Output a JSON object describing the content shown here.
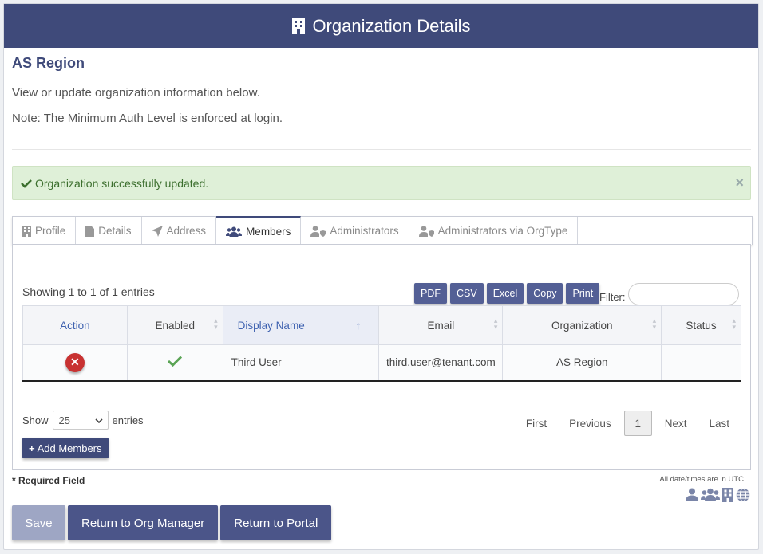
{
  "header": {
    "title": "Organization Details",
    "icon": "building-icon"
  },
  "org": {
    "name": "AS Region",
    "intro": "View or update organization information below.",
    "note": "Note: The Minimum Auth Level is enforced at login."
  },
  "alert": {
    "message": "Organization successfully updated.",
    "close": "×"
  },
  "tabs": [
    {
      "label": "Profile",
      "icon": "building-icon"
    },
    {
      "label": "Details",
      "icon": "document-icon"
    },
    {
      "label": "Address",
      "icon": "location-arrow-icon"
    },
    {
      "label": "Members",
      "icon": "users-icon"
    },
    {
      "label": "Administrators",
      "icon": "user-shield-icon"
    },
    {
      "label": "Administrators via OrgType",
      "icon": "user-shield-icon"
    }
  ],
  "table": {
    "showing": "Showing 1 to 1 of 1 entries",
    "exports": [
      "PDF",
      "CSV",
      "Excel",
      "Copy",
      "Print"
    ],
    "filter_label": "Filter:",
    "columns": [
      "Action",
      "Enabled",
      "Display Name",
      "Email",
      "Organization",
      "Status"
    ],
    "sort_arrow": "↑",
    "rows": [
      {
        "enabled": true,
        "display_name": "Third User",
        "email": "third.user@tenant.com",
        "organization": "AS Region",
        "status": ""
      }
    ],
    "show_label": "Show",
    "page_size": "25",
    "entries_label": "entries",
    "pager": {
      "first": "First",
      "previous": "Previous",
      "current": "1",
      "next": "Next",
      "last": "Last"
    },
    "add_label": "Add Members"
  },
  "footer": {
    "required": "* Required Field",
    "utc_note": "All date/times are in UTC",
    "legend_icons": [
      "user-icon",
      "users-icon",
      "building-icon",
      "globe-icon"
    ],
    "buttons": {
      "save": "Save",
      "return_org": "Return to Org Manager",
      "return_portal": "Return to Portal"
    }
  },
  "colors": {
    "brand": "#3f4a7a",
    "success_bg": "#dff0d8",
    "danger": "#c83232"
  }
}
